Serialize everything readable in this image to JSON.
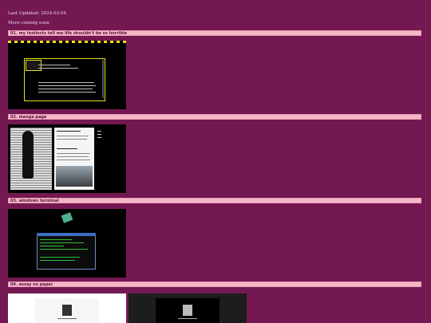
{
  "header": {
    "last_updated": "Last Updated: 2024-03-04",
    "more_coming": "More coming soon"
  },
  "sections": [
    {
      "label": "01. my instincts tell me life shouldn't be so horrible"
    },
    {
      "label": "02. manga page"
    },
    {
      "label": "03. windows terminal"
    },
    {
      "label": "04. essay on paper"
    }
  ]
}
